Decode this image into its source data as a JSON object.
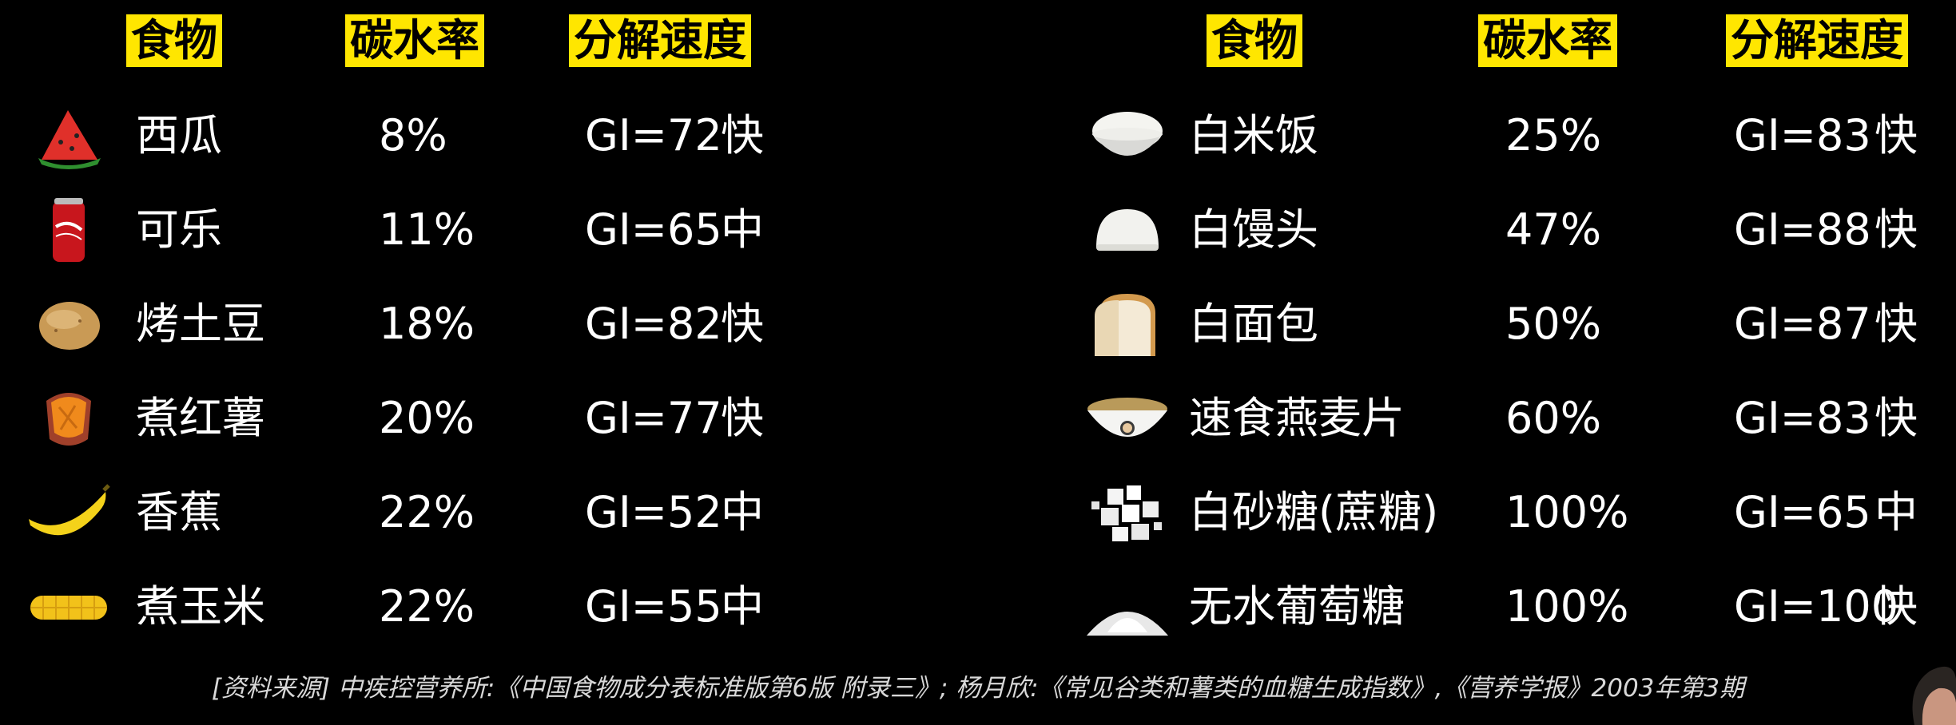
{
  "headers": {
    "food": "食物",
    "carb": "碳水率",
    "speed": "分解速度"
  },
  "left_rows": [
    {
      "icon": "watermelon-icon",
      "food": "西瓜",
      "carb": "8%",
      "gi": "GI=72",
      "speed": "快"
    },
    {
      "icon": "cola-can-icon",
      "food": "可乐",
      "carb": "11%",
      "gi": "GI=65",
      "speed": "中"
    },
    {
      "icon": "baked-potato-icon",
      "food": "烤土豆",
      "carb": "18%",
      "gi": "GI=82",
      "speed": "快"
    },
    {
      "icon": "sweet-potato-icon",
      "food": "煮红薯",
      "carb": "20%",
      "gi": "GI=77",
      "speed": "快"
    },
    {
      "icon": "banana-icon",
      "food": "香蕉",
      "carb": "22%",
      "gi": "GI=52",
      "speed": "中"
    },
    {
      "icon": "corn-icon",
      "food": "煮玉米",
      "carb": "22%",
      "gi": "GI=55",
      "speed": "中"
    }
  ],
  "right_rows": [
    {
      "icon": "rice-bowl-icon",
      "food": "白米饭",
      "carb": "25%",
      "gi": "GI=83",
      "speed": "快"
    },
    {
      "icon": "steamed-bun-icon",
      "food": "白馒头",
      "carb": "47%",
      "gi": "GI=88",
      "speed": "快"
    },
    {
      "icon": "white-bread-icon",
      "food": "白面包",
      "carb": "50%",
      "gi": "GI=87",
      "speed": "快"
    },
    {
      "icon": "oatmeal-bowl-icon",
      "food": "速食燕麦片",
      "carb": "60%",
      "gi": "GI=83",
      "speed": "快"
    },
    {
      "icon": "sugar-cubes-icon",
      "food": "白砂糖(蔗糖)",
      "carb": "100%",
      "gi": "GI=65",
      "speed": "中"
    },
    {
      "icon": "glucose-powder-icon",
      "food": "无水葡萄糖",
      "carb": "100%",
      "gi": "GI=100",
      "speed": "快"
    }
  ],
  "source": "[资料来源] 中疾控营养所:《中国食物成分表标准版第6版 附录三》; 杨月欣:《常见谷类和薯类的血糖生成指数》,《营养学报》2003年第3期",
  "colors": {
    "header_bg": "#ffe600",
    "header_text": "#000000",
    "background": "#000000",
    "text": "#ffffff"
  }
}
